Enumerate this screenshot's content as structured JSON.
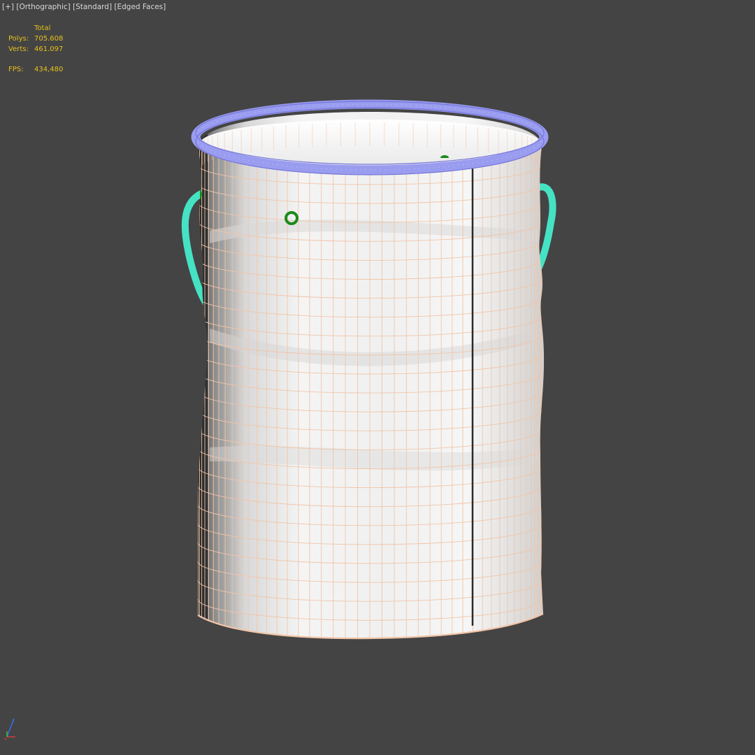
{
  "viewport": {
    "labels": [
      "[+]",
      "[Orthographic]",
      "[Standard]",
      "[Edged Faces]"
    ]
  },
  "stats": {
    "header": "Total",
    "polys_label": "Polys:",
    "polys_value": "705.608",
    "verts_label": "Verts:",
    "verts_value": "461.097",
    "fps_label": "FPS:",
    "fps_value": "434,480"
  },
  "colors": {
    "background": "#444444",
    "overlay_text": "#e6c01c",
    "body_fill": "#f2f2f2",
    "wire_edges": "#f1c5a8",
    "rim_wire": "#9a9cf0",
    "handle": "#45e3c4",
    "grommet": "#1a8a1a"
  },
  "icons": {
    "gizmo": "xyz-axis-gizmo-icon"
  }
}
